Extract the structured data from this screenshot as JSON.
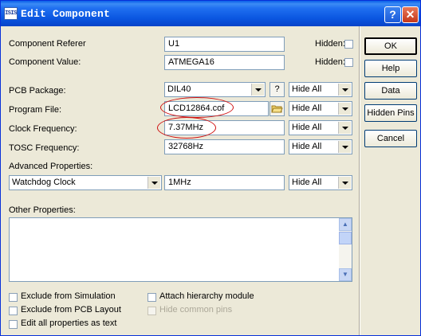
{
  "window": {
    "title": "Edit Component",
    "icon_text": "ISIS"
  },
  "titlebar_buttons": {
    "help": "?",
    "close": "✕"
  },
  "fields": {
    "reference": {
      "label": "Component Referer",
      "value": "U1",
      "hidden_label": "Hidden:"
    },
    "value": {
      "label": "Component Value:",
      "value": "ATMEGA16",
      "hidden_label": "Hidden:"
    },
    "pcb": {
      "label": "PCB Package:",
      "value": "DIL40",
      "query": "?",
      "visibility": "Hide All"
    },
    "program": {
      "label": "Program File:",
      "value": "LCD12864.cof",
      "visibility": "Hide All"
    },
    "clock": {
      "label": "Clock Frequency:",
      "value": "7.37MHz",
      "visibility": "Hide All"
    },
    "tosc": {
      "label": "TOSC Frequency:",
      "value": "32768Hz",
      "visibility": "Hide All"
    },
    "advanced": {
      "label": "Advanced Properties:",
      "property": "Watchdog Clock",
      "value": "1MHz",
      "visibility": "Hide All"
    },
    "other": {
      "label": "Other Properties:",
      "value": ""
    }
  },
  "checkboxes": {
    "exclude_sim": "Exclude from Simulation",
    "exclude_pcb": "Exclude from PCB Layout",
    "edit_all": "Edit all properties as text",
    "attach_hier": "Attach hierarchy module",
    "hide_pins": "Hide common pins"
  },
  "buttons": {
    "ok": "OK",
    "help": "Help",
    "data": "Data",
    "hidden_pins": "Hidden Pins",
    "cancel": "Cancel"
  },
  "colors": {
    "title_bar": "#0a55e0",
    "face": "#ece9d8",
    "annotation": "#d01010"
  }
}
